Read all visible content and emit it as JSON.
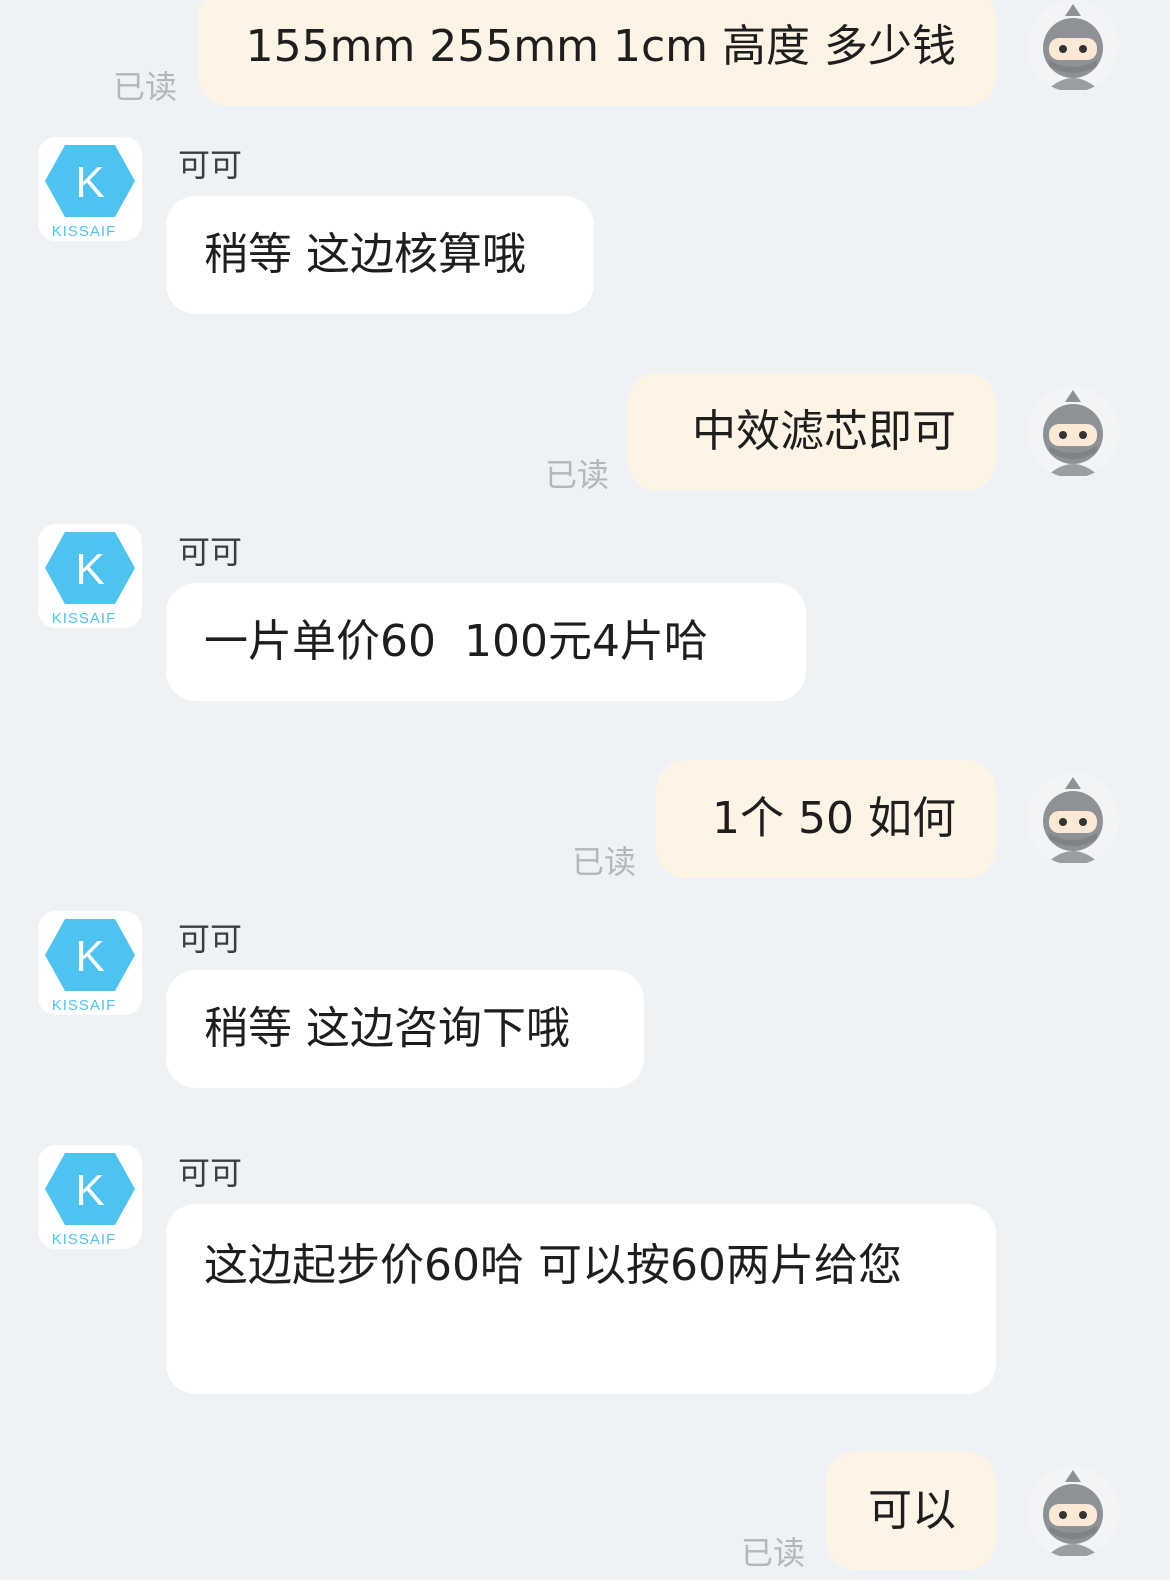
{
  "messages": [
    {
      "side": "out",
      "text": "155mm 255mm 1cm 高度 多少钱",
      "status": "已读"
    },
    {
      "side": "in",
      "sender": "可可",
      "text": "稍等 这边核算哦"
    },
    {
      "side": "out",
      "text": "中效滤芯即可",
      "status": "已读"
    },
    {
      "side": "in",
      "sender": "可可",
      "text": "一片单价60  100元4片哈"
    },
    {
      "side": "out",
      "text": "1个 50 如何",
      "status": "已读"
    },
    {
      "side": "in",
      "sender": "可可",
      "text": "稍等 这边咨询下哦"
    },
    {
      "side": "in",
      "sender": "可可",
      "text": "这边起步价60哈 可以按60两片给您"
    },
    {
      "side": "out",
      "text": "可以",
      "status": "已读"
    }
  ],
  "avatars": {
    "agent_logo_letter": "K",
    "agent_logo_text": "KISSAIF",
    "agent_logo_color": "#4fc3f0",
    "user_avatar_icon": "ninja-avatar-icon"
  },
  "colors": {
    "background": "#eff2f5",
    "outgoing_bubble": "#fdf4e6",
    "incoming_bubble": "#ffffff",
    "read_status": "#b3b6ba"
  }
}
